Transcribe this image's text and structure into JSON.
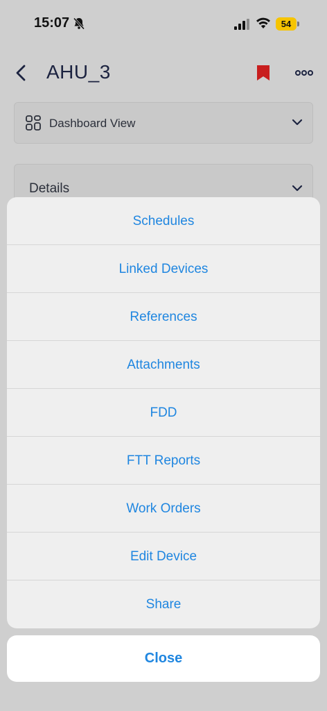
{
  "status_bar": {
    "time": "15:07",
    "battery": "54",
    "icons": [
      "bell-slash-icon",
      "signal-icon",
      "wifi-icon",
      "battery-icon"
    ]
  },
  "header": {
    "title": "AHU_3",
    "bookmark_color": "#c81e1e"
  },
  "dashboard_selector": {
    "label": "Dashboard View"
  },
  "details_section": {
    "label": "Details"
  },
  "action_sheet": {
    "items": [
      {
        "label": "Schedules"
      },
      {
        "label": "Linked Devices"
      },
      {
        "label": "References"
      },
      {
        "label": "Attachments"
      },
      {
        "label": "FDD"
      },
      {
        "label": "FTT Reports"
      },
      {
        "label": "Work Orders"
      },
      {
        "label": "Edit Device"
      },
      {
        "label": "Share"
      }
    ],
    "close_label": "Close",
    "accent_color": "#1f86e0"
  }
}
